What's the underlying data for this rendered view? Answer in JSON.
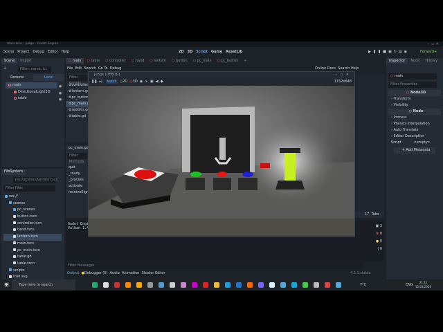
{
  "window_title": "main.tscn - judge - Godot Engine",
  "menu": [
    "Scene",
    "Project",
    "Debug",
    "Editor",
    "Help"
  ],
  "workspaces": [
    "2D",
    "3D",
    "Script",
    "Game",
    "AssetLib"
  ],
  "active_workspace": "Script",
  "renderer": "Forward+",
  "scene_dock": {
    "tabs": [
      "Scene",
      "Import"
    ],
    "filter_placeholder": "Filter: name, t:t",
    "modes": [
      "Remote",
      "Local"
    ],
    "tree": [
      {
        "name": "main",
        "type": "Node3D"
      },
      {
        "name": "DirectionalLight3D",
        "type": "light"
      },
      {
        "name": "table",
        "type": "scene"
      }
    ]
  },
  "filesystem": {
    "title": "FileSystem",
    "path": "res://scenes/lantern.tscn",
    "filter_placeholder": "Filter Files",
    "items": [
      {
        "name": "res://",
        "indent": 0,
        "folder": true
      },
      {
        "name": "scenes",
        "indent": 1,
        "folder": true
      },
      {
        "name": "pc_scenes",
        "indent": 2,
        "folder": true
      },
      {
        "name": "button.tscn",
        "indent": 2
      },
      {
        "name": "controller.tscn",
        "indent": 2
      },
      {
        "name": "hand.tscn",
        "indent": 2
      },
      {
        "name": "lantern.tscn",
        "indent": 2,
        "selected": true
      },
      {
        "name": "main.tscn",
        "indent": 2
      },
      {
        "name": "pc_main.tscn",
        "indent": 2
      },
      {
        "name": "table.gd",
        "indent": 2,
        "script": true
      },
      {
        "name": "table.tscn",
        "indent": 2
      },
      {
        "name": "scripts",
        "indent": 1,
        "folder": true
      },
      {
        "name": "icon.svg",
        "indent": 1
      }
    ]
  },
  "script_tabs": [
    "main",
    "table",
    "controller",
    "hand",
    "lantern",
    "button",
    "pc_main",
    "pc_button"
  ],
  "script_menu": [
    "File",
    "Edit",
    "Search",
    "Go To",
    "Debug"
  ],
  "script_help": [
    "Online Docs",
    "Search Help"
  ],
  "script_list": {
    "filter_placeholder": "Filter Scripts",
    "items": [
      "controller",
      "lantern.gd",
      "pc_button",
      "pc_main.gd",
      "redditn.gd",
      "table.gd"
    ],
    "selected": "pc_main.gd"
  },
  "methods": {
    "file": "pc_main.gd",
    "filter_placeholder": "Filter Methods",
    "items": [
      "quit",
      "_ready",
      "_process",
      "activate",
      "receiveSignal"
    ]
  },
  "output": {
    "lines": [
      "Godot Engine",
      "Vulkan 1.4."
    ],
    "filter_placeholder": "Filter Messages",
    "counts": {
      "info": "3",
      "errors": "0",
      "warnings": "0",
      "messages": "0"
    },
    "tabs": [
      "Output",
      "Debugger (5)",
      "Audio",
      "Animation",
      "Shader Editor"
    ],
    "version": "4.5.1.stable"
  },
  "code_status": {
    "pos": "17",
    "indent": "Tabs"
  },
  "game_window": {
    "title": "judge (DEBUG)",
    "toolbar": [
      "Input",
      "2D",
      "3D"
    ],
    "resolution": "1152x648"
  },
  "inspector": {
    "tabs": [
      "Inspector",
      "Node",
      "History"
    ],
    "node": "main",
    "filter_placeholder": "Filter Properties",
    "class": "Node3D",
    "sections": [
      "Transform",
      "Visibility"
    ],
    "node_class": "Node",
    "node_sections": [
      "Process",
      "Physics Interpolation",
      "Auto Translate",
      "Editor Description"
    ],
    "script_label": "Script",
    "script_value": "<empty>",
    "add_metadata": "Add Metadata"
  },
  "taskbar": {
    "search_placeholder": "Type here to search",
    "weather": "7°C",
    "lang": "ENG",
    "time": "21:11",
    "date": "12/01/2026"
  },
  "colors": {
    "accent": "#5fa8e8",
    "bg": "#1d2229",
    "panel": "#252b34",
    "lamp": "#c8f020"
  }
}
